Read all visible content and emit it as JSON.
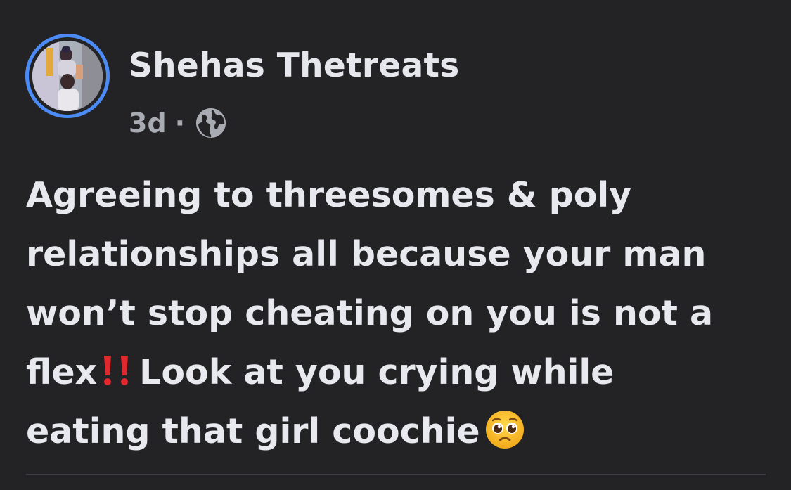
{
  "post": {
    "author": "Shehas Thetreats",
    "timestamp": "3d",
    "separator": "·",
    "audience_icon": "globe-icon",
    "text_lines": [
      "Agreeing to threesomes & poly",
      "relationships all because your man",
      "won’t stop cheating on you is not a",
      "flex",
      "Look at you crying while",
      "eating that girl coochie"
    ],
    "emojis": [
      "double-exclamation-icon",
      "pleading-face-icon"
    ]
  },
  "colors": {
    "background": "#232325",
    "avatar_ring": "#4c8bf5",
    "text": "#e8e9ee",
    "meta_text": "#a8abb1",
    "emoji_red": "#e0282e",
    "divider": "#3e3f43"
  }
}
